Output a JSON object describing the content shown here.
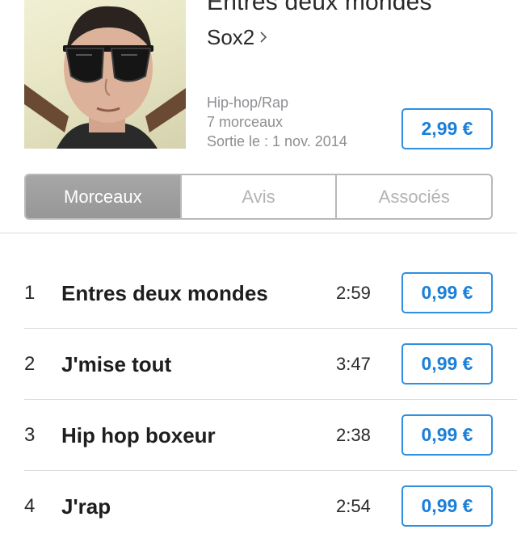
{
  "album": {
    "title": "Entres deux mondes",
    "artist": "Sox2",
    "genre": "Hip-hop/Rap",
    "track_count": "7 morceaux",
    "release": "Sortie le : 1 nov. 2014",
    "price": "2,99 €",
    "artwork_icon": "album-cover-portrait"
  },
  "tabs": [
    {
      "label": "Morceaux",
      "active": true
    },
    {
      "label": "Avis",
      "active": false
    },
    {
      "label": "Associés",
      "active": false
    }
  ],
  "tracks": [
    {
      "number": "1",
      "title": "Entres deux mondes",
      "duration": "2:59",
      "price": "0,99 €"
    },
    {
      "number": "2",
      "title": "J'mise tout",
      "duration": "3:47",
      "price": "0,99 €"
    },
    {
      "number": "3",
      "title": "Hip hop boxeur",
      "duration": "2:38",
      "price": "0,99 €"
    },
    {
      "number": "4",
      "title": "J'rap",
      "duration": "2:54",
      "price": "0,99 €"
    }
  ],
  "colors": {
    "accent": "#1a7fd8",
    "active_tab": "#9e9e9e",
    "secondary_text": "#8e8e93"
  }
}
